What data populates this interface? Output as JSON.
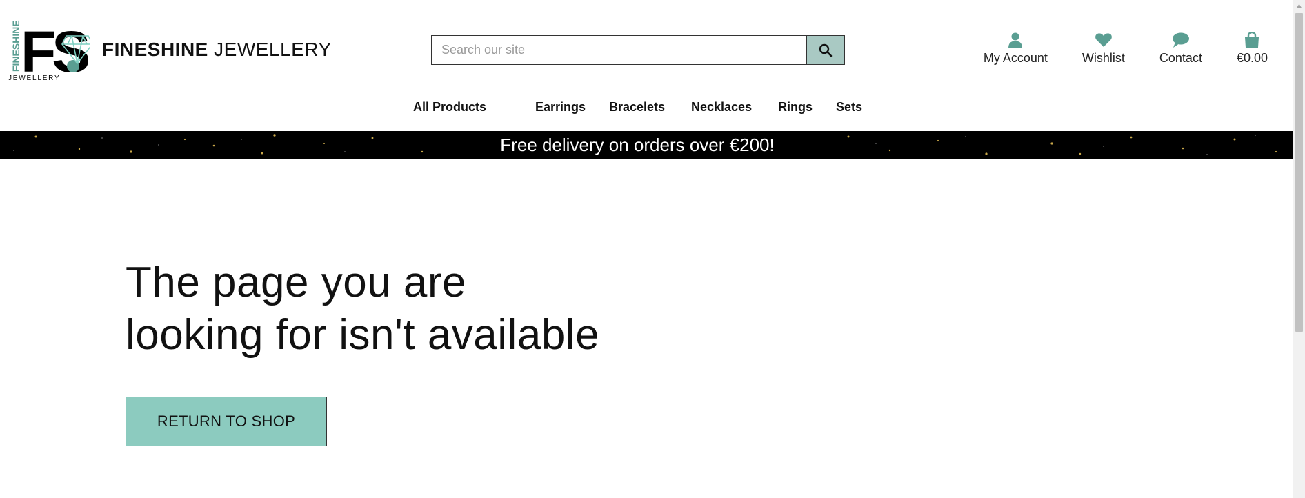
{
  "brand": {
    "logo_letters": "FS.",
    "logo_vertical": "FINESHINE",
    "logo_sub": "JEWELLERY",
    "name_bold": "FINESHINE",
    "name_light": "JEWELLERY",
    "accent_color": "#5a9e92"
  },
  "search": {
    "placeholder": "Search our site",
    "icon": "search-icon"
  },
  "header_links": [
    {
      "label": "My Account",
      "icon": "user-icon"
    },
    {
      "label": "Wishlist",
      "icon": "heart-icon"
    },
    {
      "label": "Contact",
      "icon": "chat-icon"
    },
    {
      "label": "€0.00",
      "icon": "shopping-bag-icon"
    }
  ],
  "nav": [
    {
      "label": "All Products"
    },
    {
      "label": "Earrings"
    },
    {
      "label": "Bracelets"
    },
    {
      "label": "Necklaces"
    },
    {
      "label": "Rings"
    },
    {
      "label": "Sets"
    }
  ],
  "promo": {
    "text": "Free delivery on orders over €200!"
  },
  "error": {
    "line1": "The page you are",
    "line2": "looking for isn't available",
    "button": "RETURN TO SHOP"
  },
  "colors": {
    "cta_bg": "#8ccbbf",
    "search_button_bg": "#a9c9c3",
    "promo_bg": "#000000"
  }
}
